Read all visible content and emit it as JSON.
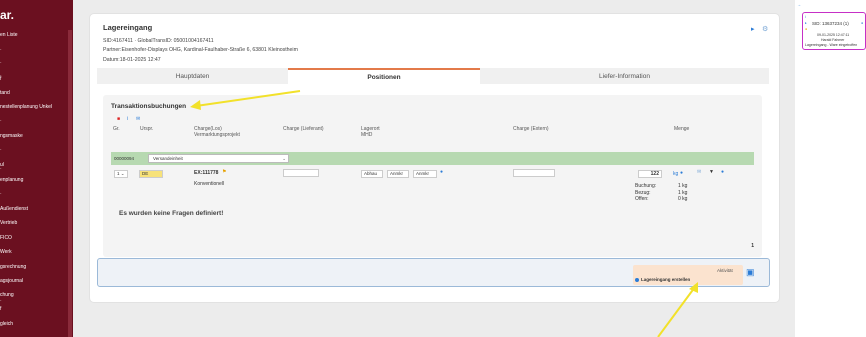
{
  "sidebar": {
    "logo": "ar.",
    "items": [
      "en Liste",
      "·",
      "·",
      "·",
      "f",
      "tand",
      "nestellenplanung Unkel",
      "·",
      "ngsmaske",
      "·",
      "ul",
      "·",
      "enplanung",
      "·",
      "Außendienst",
      "Vertrieb",
      "FICO",
      "Werk",
      "gsrechnung",
      "agsjournal",
      "chung",
      "·",
      "f",
      "gleich"
    ]
  },
  "header": {
    "title": "Lagereingang",
    "sid_line": "SID:4167411 · GlobalTransID: 05001004167411",
    "partner_line": "Partner:Eisenhofer-Displays OHG, Kardinal-Faulhaber-Straße 6, 63801 Kleinostheim",
    "datum_line": "Datum:18-01-2025 12:47"
  },
  "tabs": [
    "Hauptdaten",
    "Positionen",
    "Liefer-Information"
  ],
  "section": {
    "title": "Transaktionsbuchungen",
    "columns": {
      "gr": "Gr.",
      "urspr": "Urspr.",
      "charge_line1": "Charge(Los)",
      "charge_line2": "Vermarktungsprojekt",
      "charge_lieferant": "Charge (Lieferant)",
      "lagerort_line1": "Lagerort",
      "lagerort_line2": "MHD",
      "charge_extern": "Charge (Extern)",
      "menge": "Menge"
    },
    "green_row": {
      "code": "00000094",
      "select_value": "Versandeinheit"
    },
    "row": {
      "gr": "1",
      "urspr": "DE",
      "article_code": "EX:111778",
      "article_sub": "Konventionell",
      "lager1": "Abhau",
      "lager2": "Anmkr",
      "lager3": "Anmkr",
      "qty": "122",
      "unit": "kg",
      "buchung_label": "Buchung:",
      "buchung_value": "1  kg",
      "bezug_label": "Bezug:",
      "bezug_value": "1  kg",
      "offen_label": "Offen:",
      "offen_value": "0  kg"
    },
    "empty_message": "Es wurden keine Fragen definiert!",
    "page_number": "1"
  },
  "action": {
    "aktivitat_label": "Aktivität",
    "option_label": "Lagereingang erstellen"
  },
  "right_panel": {
    "sid": "SID: 13637234 (1)",
    "date": "09-01-2025 12:47:11",
    "name": "Harald Fahmer",
    "status": "Lagereingang - Ware eingetroffen"
  },
  "colors": {
    "sidebar_bg": "#6b1020",
    "active_tab_accent": "#e37a4a",
    "green_row": "#b7d9b1",
    "highlight_card_border": "#c630c6",
    "arrow": "#f2e12a"
  },
  "icons": {
    "header": [
      "share-icon",
      "settings-icon"
    ],
    "toolbar": [
      "delete-icon",
      "info-icon",
      "mail-icon"
    ],
    "save": "save-icon"
  }
}
